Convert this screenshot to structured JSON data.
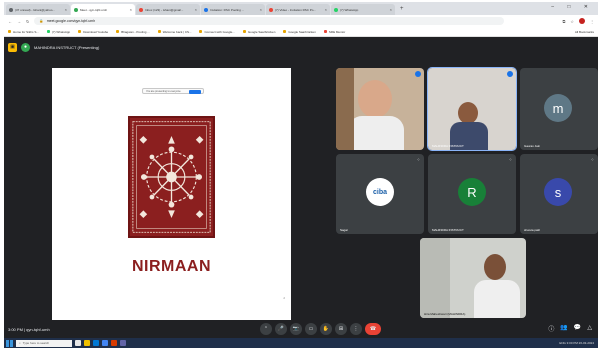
{
  "browser": {
    "tabs": [
      {
        "label": "(37 unread) - Ishani@yahoo..."
      },
      {
        "label": "Meet - qyn-tqhf-umh",
        "active": true
      },
      {
        "label": "Inbox (123) - ishani@gmail..."
      },
      {
        "label": "Invitation: RSC Pooling ..."
      },
      {
        "label": "(7) Video - Invitation RSC Po..."
      },
      {
        "label": "(7) WhatsApp"
      }
    ],
    "new_tab": "+",
    "window_controls": "– □ ✕",
    "url": "meet.google.com/qyn-tqhf-umh",
    "bookmarks": [
      "Home for Sikhs S...",
      "(7) WhatsApp",
      "Download Youtube",
      "Bhagwan - Pooling ...",
      "Welcome back | CS...",
      "Connect with Google...",
      "Google Saarbrücken",
      "Google Saarbrücken",
      "SRE Mentor"
    ],
    "bookmarks_right": "All Bookmarks"
  },
  "meet": {
    "presenter": "MAHINDRA INSTRUCT (Presenting)",
    "slide": {
      "share_bar": "You are presenting to everyone",
      "title": "NIRMAAN",
      "page": "2"
    },
    "tiles": [
      {
        "id": "p1",
        "name": ""
      },
      {
        "id": "p2",
        "name": "MAHINDRA INSTRUCT"
      },
      {
        "id": "p3",
        "name": "Gaurav Jain",
        "initial": "m",
        "color": "#5f7886"
      },
      {
        "id": "p4",
        "name": "Sagar",
        "logo": "ciba"
      },
      {
        "id": "p5",
        "name": "MAHINDRA INSTRUCT",
        "initial": "R",
        "color": "#188038"
      },
      {
        "id": "p6",
        "name": "shweta patil",
        "initial": "s",
        "color": "#3949ab"
      },
      {
        "id": "p7",
        "name": "Hira Maheshwari (MAHINDRA)"
      }
    ],
    "time": "3:00 PM | qyn-tqhf-umh",
    "controls": [
      "⌃",
      "🎤",
      "📷",
      "▭",
      "✋",
      "⊞",
      "⋮"
    ],
    "end_call_icon": "phone-hangup-icon",
    "right_controls": [
      "ⓘ",
      "👥",
      "💬",
      "△"
    ]
  },
  "taskbar": {
    "search_placeholder": "Type here to search",
    "tray": "ENG  3:00 PM  26-03-2024"
  },
  "colors": {
    "meet_bg": "#202124",
    "tile_bg": "#3c4043",
    "accent_blue": "#1a73e8",
    "end_call": "#ea4335",
    "slide_maroon": "#8b1f1f"
  }
}
